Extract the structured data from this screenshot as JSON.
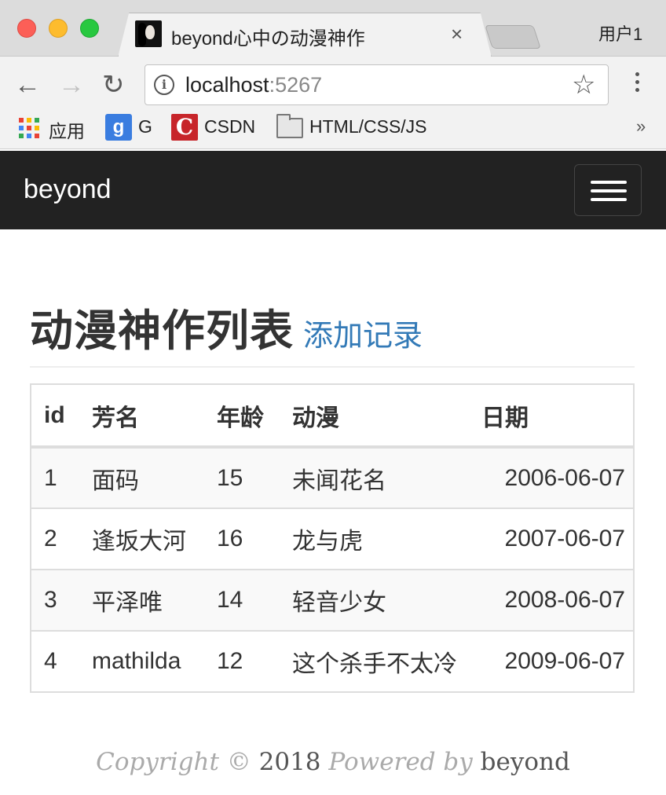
{
  "window": {
    "tab_title": "beyond心中の动漫神作",
    "tab_close": "×",
    "profile": "用户1"
  },
  "toolbar": {
    "url_host": "localhost",
    "url_port": ":5267",
    "icons": [
      "back-icon",
      "forward-icon",
      "reload-icon",
      "info-icon",
      "star-icon",
      "menu-icon"
    ]
  },
  "bookmarks": [
    {
      "label": "应用",
      "icon": "apps-icon"
    },
    {
      "label": "G",
      "icon": "google-icon"
    },
    {
      "label": "CSDN",
      "icon": "csdn-icon"
    },
    {
      "label": "HTML/CSS/JS",
      "icon": "folder-icon"
    }
  ],
  "bookmarks_overflow": "»",
  "navbar": {
    "brand": "beyond"
  },
  "header": {
    "title": "动漫神作列表",
    "add_link": "添加记录"
  },
  "table": {
    "columns": [
      "id",
      "芳名",
      "年龄",
      "动漫",
      "日期"
    ],
    "rows": [
      [
        "1",
        "面码",
        "15",
        "未闻花名",
        "2006-06-07"
      ],
      [
        "2",
        "逢坂大河",
        "16",
        "龙与虎",
        "2007-06-07"
      ],
      [
        "3",
        "平泽唯",
        "14",
        "轻音少女",
        "2008-06-07"
      ],
      [
        "4",
        "mathilda",
        "12",
        "这个杀手不太冷",
        "2009-06-07"
      ]
    ]
  },
  "footer": {
    "copyright": "Copyright ©",
    "year": "2018",
    "powered": "Powered by",
    "author": "beyond"
  },
  "colors": {
    "navbar": "#222222",
    "link": "#337ab7",
    "stripe": "#f9f9f9"
  }
}
